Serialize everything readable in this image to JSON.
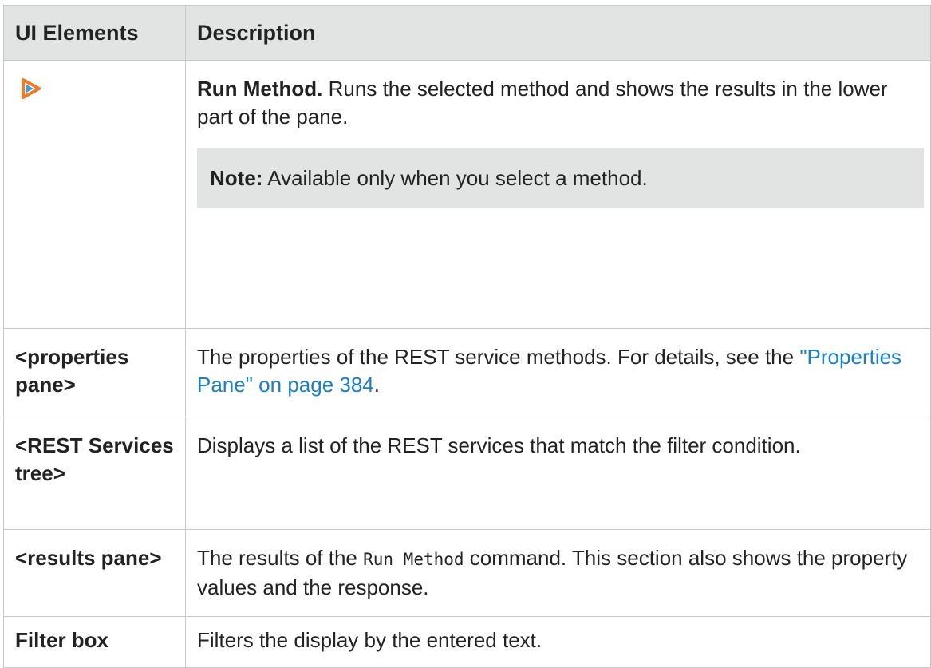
{
  "table": {
    "headers": {
      "ui_elements": "UI Elements",
      "description": "Description"
    },
    "rows": [
      {
        "element_icon": "run-method-icon",
        "desc_term": "Run Method.",
        "desc_text": " Runs the selected method and shows the results in the lower part of the pane.",
        "note_label": "Note:",
        "note_text": " Available only when you select a method."
      },
      {
        "element": "<properties pane>",
        "desc_text": "The properties of the REST service methods. For details, see the ",
        "desc_link": "\"Properties Pane\" on page 384",
        "desc_after": "."
      },
      {
        "element": "<REST Services tree>",
        "desc_text": "Displays a list of the REST services that match the filter condition."
      },
      {
        "element": "<results pane>",
        "desc_before": "The results of the ",
        "desc_code": "Run Method",
        "desc_after": " command. This section also shows the property values and the response."
      },
      {
        "element": "Filter box",
        "desc_text": "Filters the display by the entered text."
      }
    ]
  },
  "colors": {
    "header_bg": "#e2e4e4",
    "link": "#1c7fc4",
    "icon_orange": "#f07a2a",
    "icon_blue": "#3aa0e0"
  }
}
